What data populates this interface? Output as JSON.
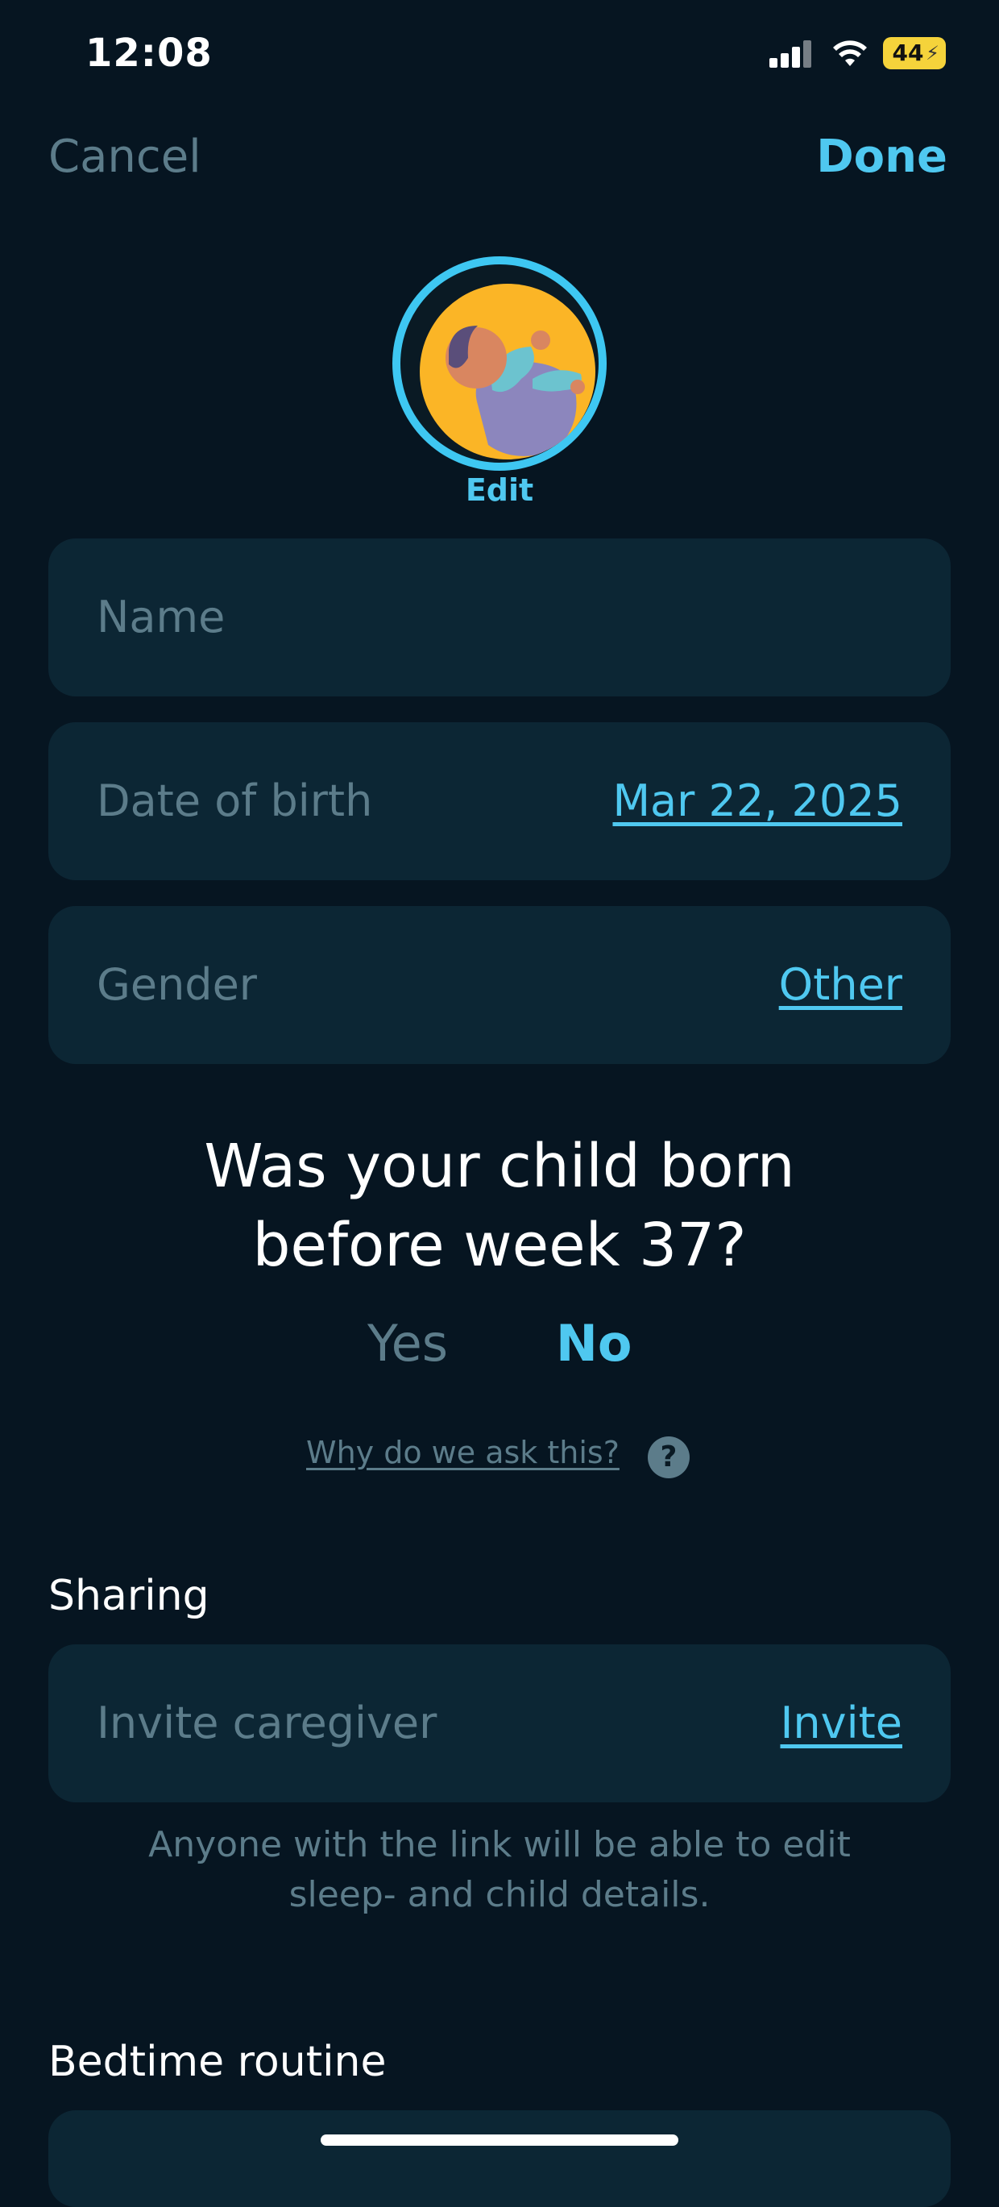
{
  "status_bar": {
    "time": "12:08",
    "battery": "44"
  },
  "nav": {
    "cancel_label": "Cancel",
    "done_label": "Done"
  },
  "avatar": {
    "edit_label": "Edit"
  },
  "form": {
    "name_placeholder": "Name",
    "dob_label": "Date of birth",
    "dob_value": "Mar 22, 2025",
    "gender_label": "Gender",
    "gender_value": "Other"
  },
  "premature": {
    "question_line1": "Was your child born",
    "question_line2": "before week 37?",
    "yes_label": "Yes",
    "no_label": "No",
    "why_label": "Why do we ask this?",
    "help_symbol": "?"
  },
  "sharing": {
    "title": "Sharing",
    "invite_label": "Invite caregiver",
    "invite_action": "Invite",
    "note_line1": "Anyone with the link will be able to edit",
    "note_line2": "sleep- and child details."
  },
  "bedtime": {
    "title": "Bedtime routine"
  },
  "colors": {
    "background": "#061521",
    "card": "#0c2634",
    "accent": "#4fc8f0",
    "muted": "#5c7c8a"
  }
}
